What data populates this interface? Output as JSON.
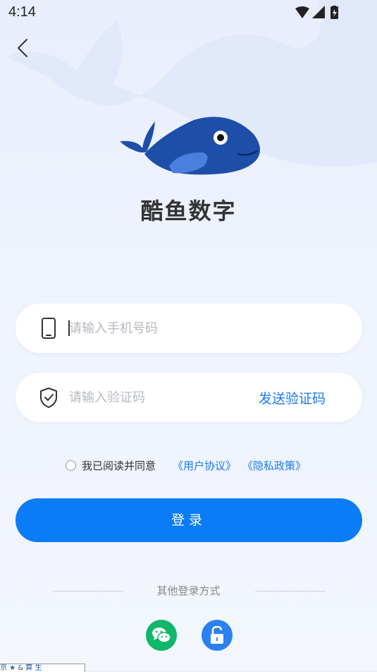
{
  "status_bar": {
    "time": "4:14"
  },
  "app": {
    "name": "酷鱼数字"
  },
  "phone_field": {
    "placeholder": "请输入手机号码",
    "value": ""
  },
  "code_field": {
    "placeholder": "请输入验证码",
    "value": "",
    "send_code_label": "发送验证码"
  },
  "agreement": {
    "text": "我已阅读并同意",
    "user_agreement": "《用户协议》",
    "privacy_policy": "《隐私政策》",
    "checked": false
  },
  "login_button": {
    "label": "登录"
  },
  "other_login": {
    "label": "其他登录方式",
    "options": [
      {
        "name": "wechat",
        "icon": "wechat-icon"
      },
      {
        "name": "lock",
        "icon": "lock-icon"
      }
    ]
  },
  "colors": {
    "accent": "#0a7cf7",
    "link": "#1a7cf5",
    "wechat": "#10b66a",
    "lock": "#2d80f1"
  },
  "bottom_tag": "京 ★ & 算 生"
}
